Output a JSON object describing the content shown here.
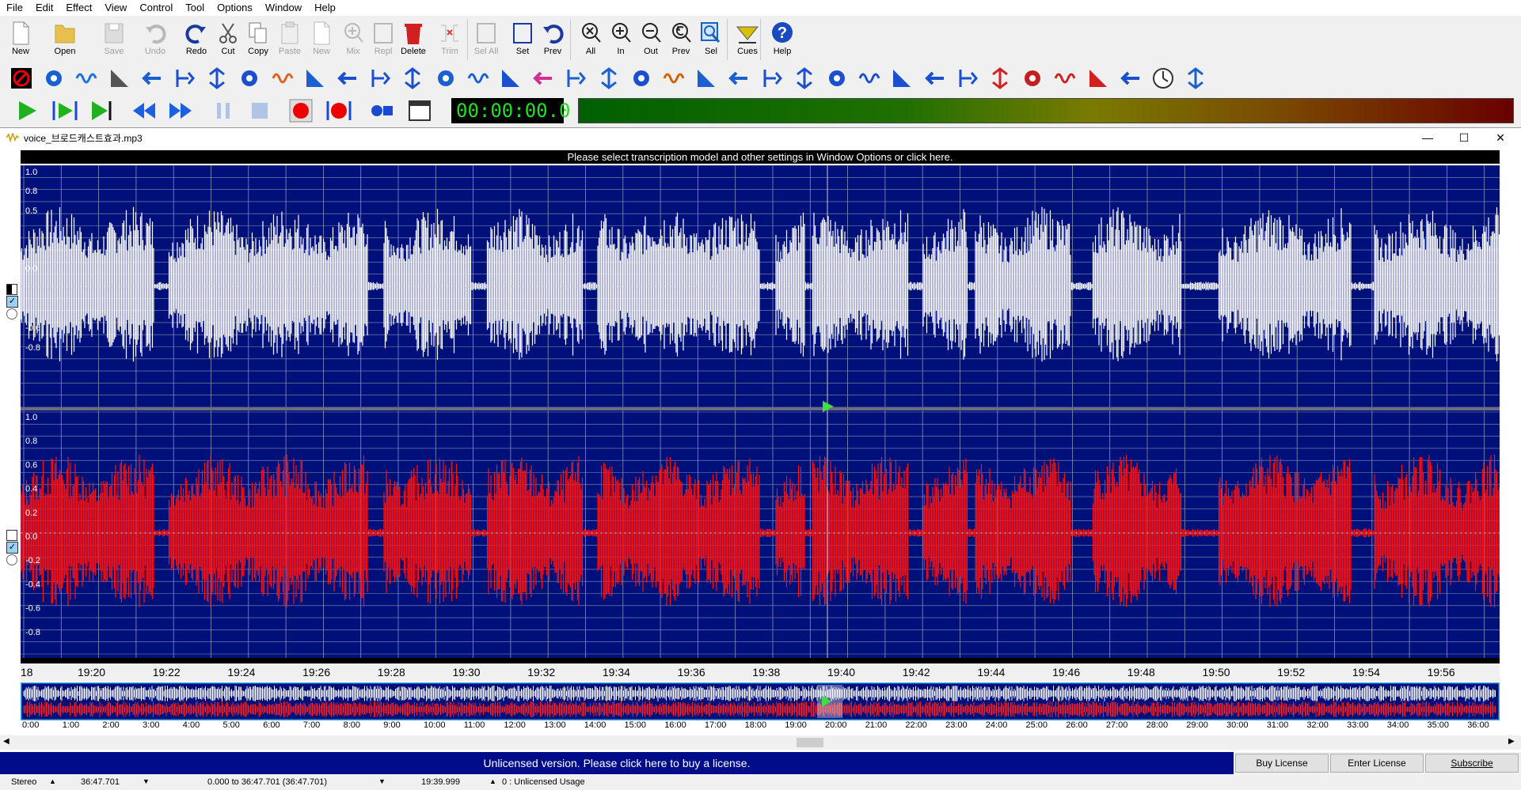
{
  "menu": [
    "File",
    "Edit",
    "Effect",
    "View",
    "Control",
    "Tool",
    "Options",
    "Window",
    "Help"
  ],
  "toolbar": [
    {
      "name": "new-button",
      "label": "New",
      "enabled": true
    },
    {
      "name": "open-button",
      "label": "Open",
      "enabled": true
    },
    {
      "name": "save-button",
      "label": "Save",
      "enabled": false
    },
    {
      "name": "undo-button",
      "label": "Undo",
      "enabled": false
    },
    {
      "name": "redo-button",
      "label": "Redo",
      "enabled": true
    },
    {
      "name": "cut-button",
      "label": "Cut",
      "enabled": true
    },
    {
      "name": "copy-button",
      "label": "Copy",
      "enabled": true
    },
    {
      "name": "paste-button",
      "label": "Paste",
      "enabled": false
    },
    {
      "name": "paste-new-button",
      "label": "New",
      "enabled": false
    },
    {
      "name": "mix-button",
      "label": "Mix",
      "enabled": false
    },
    {
      "name": "replace-button",
      "label": "Repl",
      "enabled": false
    },
    {
      "name": "delete-button",
      "label": "Delete",
      "enabled": true
    },
    {
      "name": "trim-button",
      "label": "Trim",
      "enabled": false
    },
    {
      "name": "select-all-button",
      "label": "Sel All",
      "enabled": false
    },
    {
      "name": "set-selection-button",
      "label": "Set",
      "enabled": true
    },
    {
      "name": "prev-selection-button",
      "label": "Prev",
      "enabled": true
    },
    {
      "name": "zoom-all-button",
      "label": "All",
      "enabled": true
    },
    {
      "name": "zoom-in-button",
      "label": "In",
      "enabled": true
    },
    {
      "name": "zoom-out-button",
      "label": "Out",
      "enabled": true
    },
    {
      "name": "zoom-prev-button",
      "label": "Prev",
      "enabled": true
    },
    {
      "name": "zoom-selection-button",
      "label": "Sel",
      "enabled": true
    },
    {
      "name": "cues-button",
      "label": "Cues",
      "enabled": true
    },
    {
      "name": "help-button",
      "label": "Help",
      "enabled": true
    }
  ],
  "time_display": "00:00:00.0",
  "document": {
    "title": "voice_브로드캐스트효과.mp3",
    "transcription_bar": "Please select transcription model and other settings in Window Options or click here.",
    "amp_labels_top": [
      "1.0",
      "0.8",
      "0.5",
      "0.0",
      "-0.6",
      "-0.8"
    ],
    "amp_labels_bottom": [
      "1.0",
      "0.8",
      "0.6",
      "0.4",
      "0.2",
      "0.0",
      "-0.2",
      "-0.4",
      "-0.6",
      "-0.8"
    ],
    "timeline_labels": [
      "18",
      "19:20",
      "19:22",
      "19:24",
      "19:26",
      "19:28",
      "19:30",
      "19:32",
      "19:34",
      "19:36",
      "19:38",
      "19:40",
      "19:42",
      "19:44",
      "19:46",
      "19:48",
      "19:50",
      "19:52",
      "19:54",
      "19:56"
    ],
    "overview_labels": [
      "0:00",
      "1:00",
      "2:00",
      "3:00",
      "4:00",
      "5:00",
      "6:00",
      "7:00",
      "8:00",
      "9:00",
      "10:00",
      "11:00",
      "12:00",
      "13:00",
      "14:00",
      "15:00",
      "16:00",
      "17:00",
      "18:00",
      "19:00",
      "20:00",
      "21:00",
      "22:00",
      "23:00",
      "24:00",
      "25:00",
      "26:00",
      "27:00",
      "28:00",
      "29:00",
      "30:00",
      "31:00",
      "32:00",
      "33:00",
      "34:00",
      "35:00",
      "36:00"
    ],
    "colors": {
      "wave_bg": "#00107a",
      "channel1": "#ffffff",
      "channel2": "#ff1010",
      "grid": "#8a8fb0",
      "playhead": "#40e040"
    }
  },
  "license": {
    "message": "Unlicensed version. Please click here to buy a license.",
    "buy": "Buy License",
    "enter": "Enter License",
    "subscribe": "Subscribe"
  },
  "status": {
    "channels": "Stereo",
    "length": "36:47.701",
    "selection": "0.000 to 36:47.701 (36:47.701)",
    "cursor": "19:39.999",
    "usage": "0 : Unlicensed Usage"
  }
}
